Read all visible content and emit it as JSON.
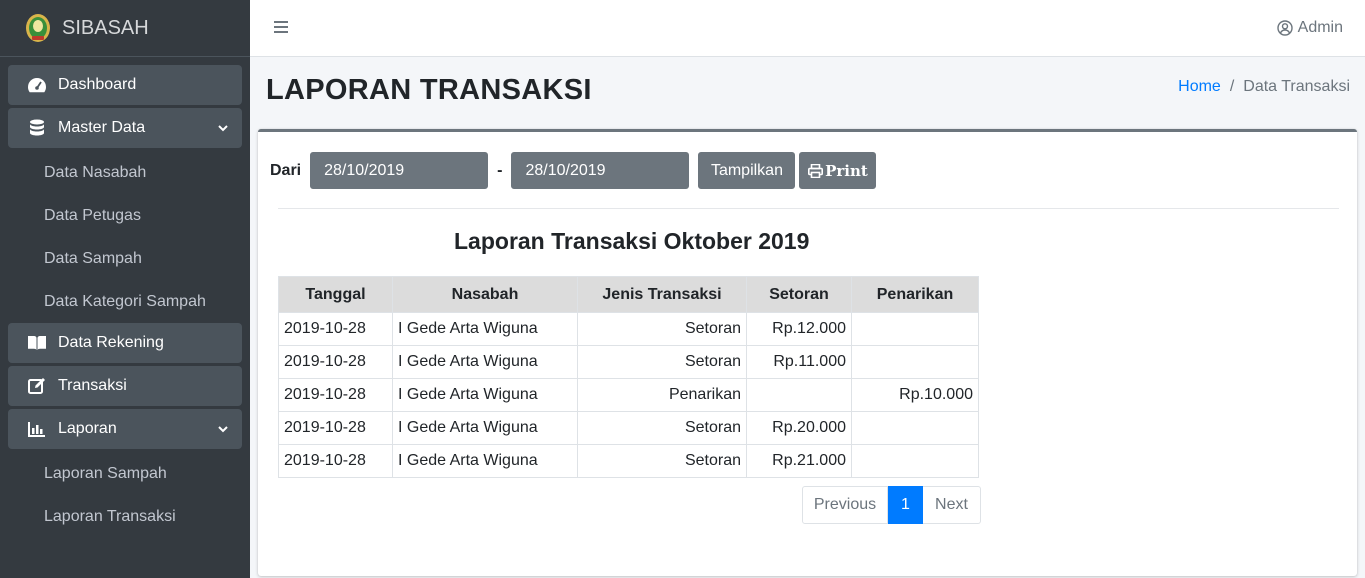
{
  "brand": {
    "name": "SIBASAH",
    "logo_icon": "emblem-logo"
  },
  "sidebar": {
    "items": [
      {
        "label": "Dashboard",
        "icon": "tachometer-icon"
      },
      {
        "label": "Master Data",
        "icon": "database-icon"
      },
      {
        "label": "Data Nasabah"
      },
      {
        "label": "Data Petugas"
      },
      {
        "label": "Data Sampah"
      },
      {
        "label": "Data Kategori Sampah"
      },
      {
        "label": "Data Rekening",
        "icon": "book-icon"
      },
      {
        "label": "Transaksi",
        "icon": "edit-icon"
      },
      {
        "label": "Laporan",
        "icon": "bar-chart-icon"
      },
      {
        "label": "Laporan Sampah"
      },
      {
        "label": "Laporan Transaksi"
      }
    ]
  },
  "topbar": {
    "user": "Admin"
  },
  "page": {
    "title": "LAPORAN TRANSAKSI",
    "breadcrumb": {
      "home": "Home",
      "separator": "/",
      "current": "Data Transaksi"
    }
  },
  "filter": {
    "label_from": "Dari",
    "date_from": "28/10/2019",
    "separator": "-",
    "date_to": "28/10/2019",
    "show_button": "Tampilkan",
    "print_button": "Print"
  },
  "report": {
    "title": "Laporan Transaksi Oktober 2019",
    "columns": [
      "Tanggal",
      "Nasabah",
      "Jenis Transaksi",
      "Setoran",
      "Penarikan"
    ],
    "rows": [
      [
        "2019-10-28",
        "I Gede Arta Wiguna",
        "Setoran",
        "Rp.12.000",
        ""
      ],
      [
        "2019-10-28",
        "I Gede Arta Wiguna",
        "Setoran",
        "Rp.11.000",
        ""
      ],
      [
        "2019-10-28",
        "I Gede Arta Wiguna",
        "Penarikan",
        "",
        "Rp.10.000"
      ],
      [
        "2019-10-28",
        "I Gede Arta Wiguna",
        "Setoran",
        "Rp.20.000",
        ""
      ],
      [
        "2019-10-28",
        "I Gede Arta Wiguna",
        "Setoran",
        "Rp.21.000",
        ""
      ]
    ]
  },
  "pagination": {
    "previous": "Previous",
    "current": "1",
    "next": "Next"
  },
  "colors": {
    "sidebar_bg": "#343a40",
    "accent": "#007bff",
    "secondary": "#6c757d"
  }
}
